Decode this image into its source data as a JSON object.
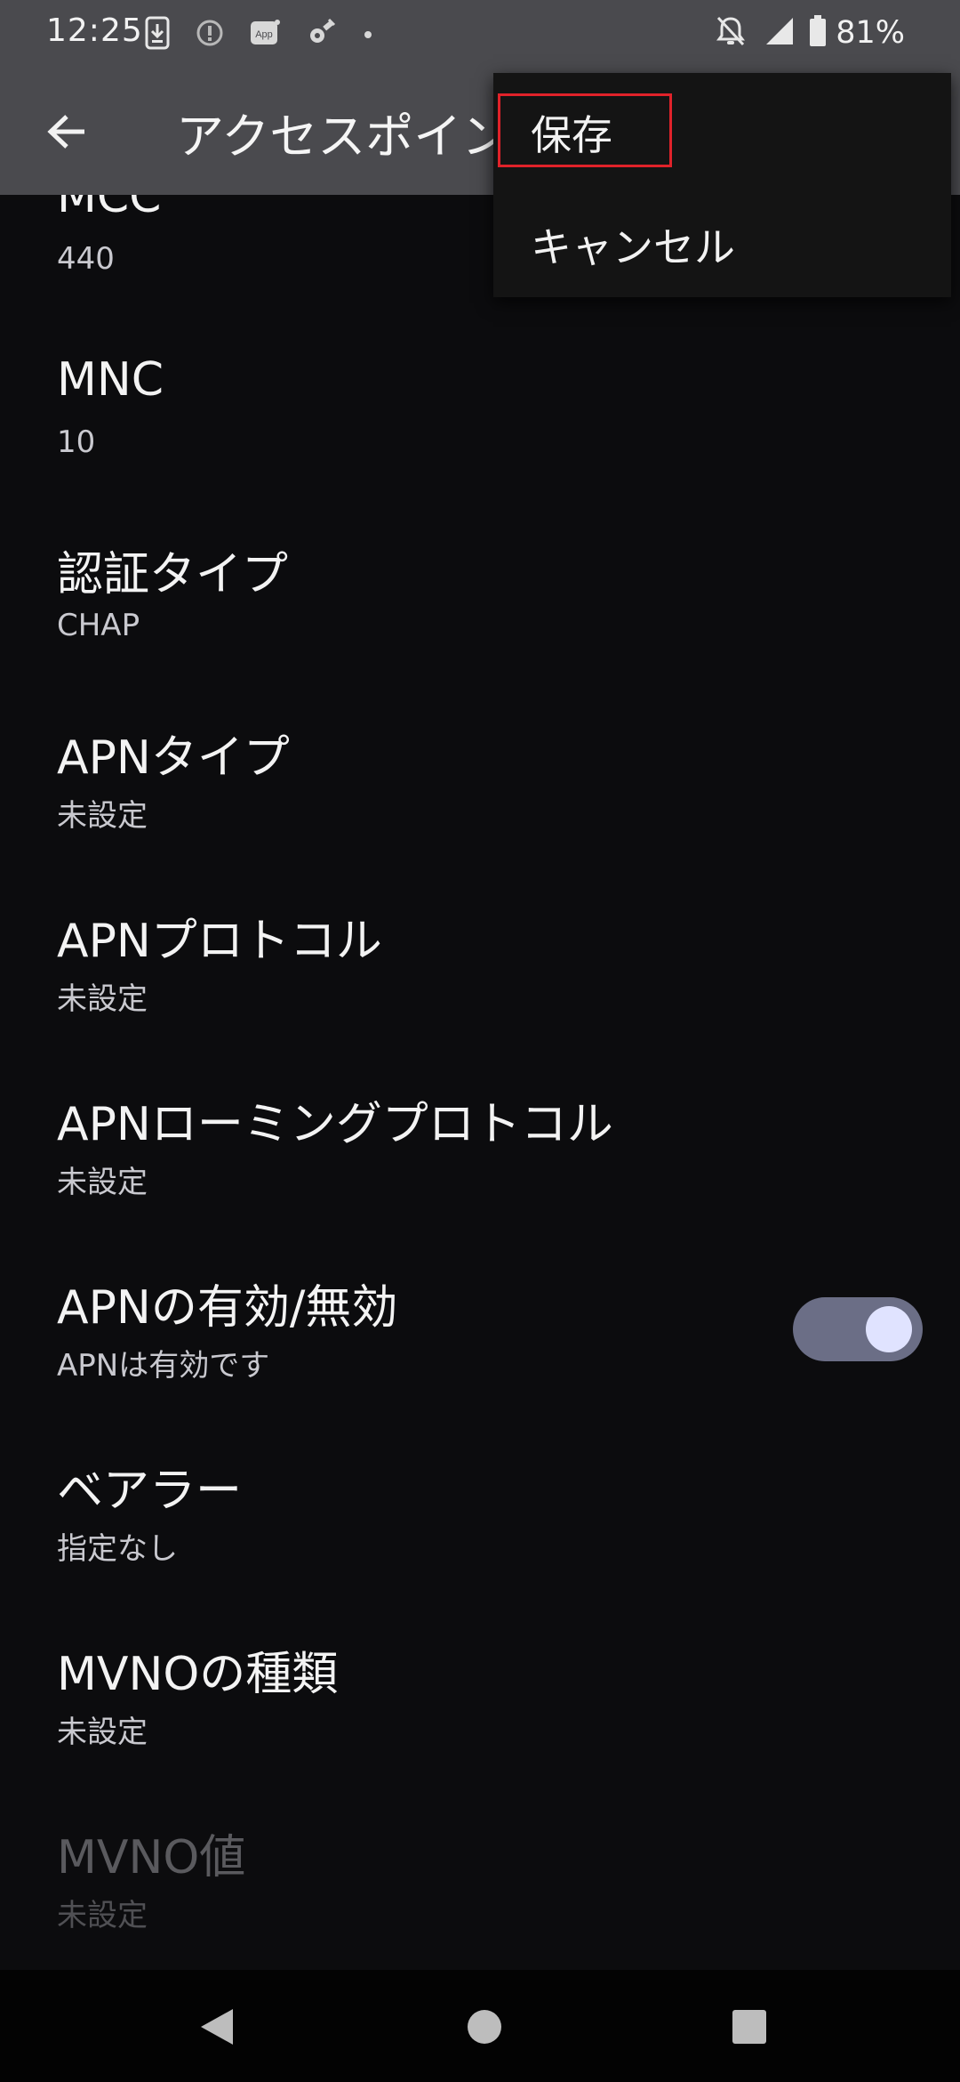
{
  "status_bar": {
    "time": "12:25",
    "battery_percent": "81%",
    "icons_left": [
      "download-icon",
      "info-circle-icon",
      "app-icon",
      "satellite-icon",
      "dot-icon"
    ],
    "icons_right": [
      "bell-off-icon",
      "signal-icon",
      "battery-icon"
    ]
  },
  "app_bar": {
    "title": "アクセスポイン"
  },
  "menu": {
    "items": [
      {
        "label": "保存"
      },
      {
        "label": "キャンセル"
      }
    ]
  },
  "preferences": [
    {
      "title": "MCC",
      "summary": "440"
    },
    {
      "title": "MNC",
      "summary": "10"
    },
    {
      "title": "認証タイプ",
      "summary": "CHAP"
    },
    {
      "title": "APNタイプ",
      "summary": "未設定"
    },
    {
      "title": "APNプロトコル",
      "summary": "未設定"
    },
    {
      "title": "APNローミングプロトコル",
      "summary": "未設定"
    },
    {
      "title": "APNの有効/無効",
      "summary": "APNは有効です",
      "toggle_on": true
    },
    {
      "title": "ベアラー",
      "summary": "指定なし"
    },
    {
      "title": "MVNOの種類",
      "summary": "未設定"
    },
    {
      "title": "MVNO値",
      "summary": "未設定",
      "disabled": true
    }
  ],
  "colors": {
    "status_bar_bg": "#4a4a4e",
    "background": "#0c0c0e",
    "toggle_track": "#6b6e86",
    "toggle_knob": "#e0e3ff",
    "highlight": "#e0222a"
  }
}
